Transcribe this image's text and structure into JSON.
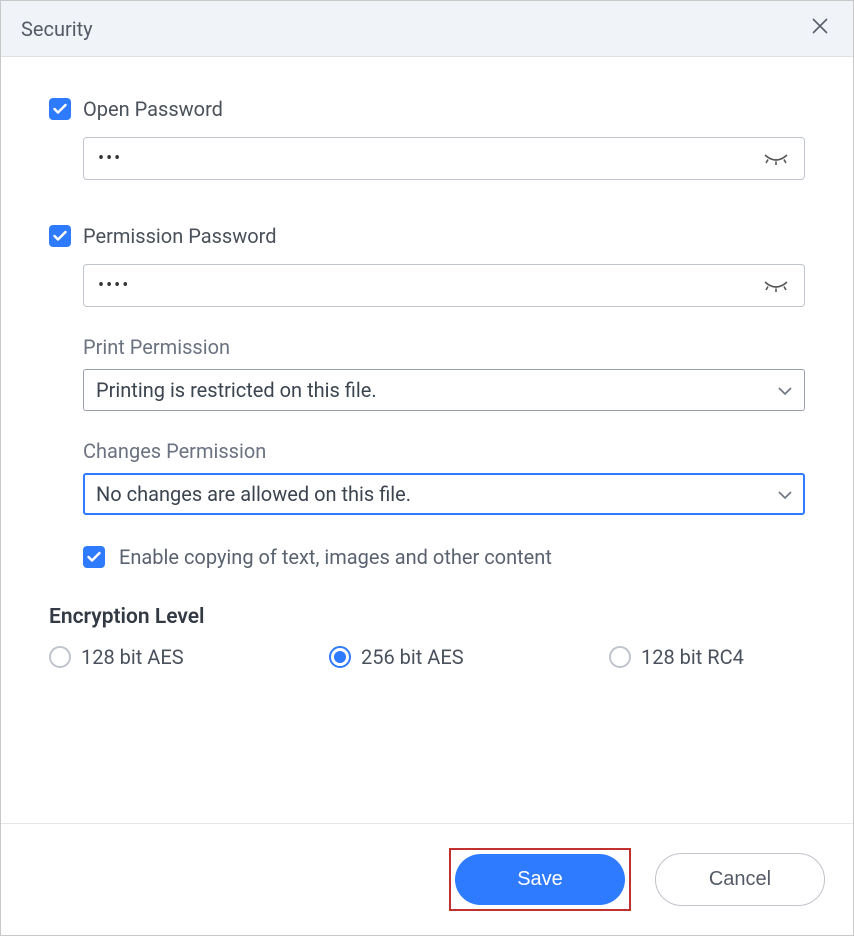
{
  "titlebar": {
    "title": "Security"
  },
  "openPassword": {
    "label": "Open Password",
    "checked": true,
    "value_masked": "•••"
  },
  "permissionPassword": {
    "label": "Permission Password",
    "checked": true,
    "value_masked": "••••"
  },
  "printPermission": {
    "label": "Print Permission",
    "value": "Printing is restricted on this file."
  },
  "changesPermission": {
    "label": "Changes Permission",
    "value": "No changes are allowed on this file."
  },
  "enableCopy": {
    "checked": true,
    "label": "Enable copying of text, images and other content"
  },
  "encryption": {
    "title": "Encryption Level",
    "options": [
      {
        "label": "128 bit AES",
        "selected": false
      },
      {
        "label": "256 bit AES",
        "selected": true
      },
      {
        "label": "128 bit RC4",
        "selected": false
      }
    ]
  },
  "buttons": {
    "save": "Save",
    "cancel": "Cancel"
  }
}
